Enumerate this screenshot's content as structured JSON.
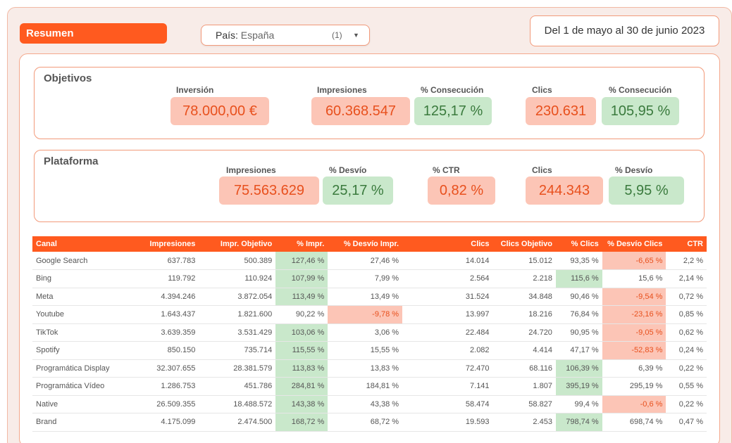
{
  "header": {
    "title": "Resumen",
    "country_label": "País",
    "country_value": "España",
    "country_count": "(1)",
    "date_range": "Del 1 de mayo al 30 de junio 2023"
  },
  "objetivos": {
    "title": "Objetivos",
    "inversion_label": "Inversión",
    "inversion_value": "78.000,00 €",
    "impresiones_label": "Impresiones",
    "impresiones_value": "60.368.547",
    "consecucion1_label": "% Consecución",
    "consecucion1_value": "125,17 %",
    "clics_label": "Clics",
    "clics_value": "230.631",
    "consecucion2_label": "% Consecución",
    "consecucion2_value": "105,95 %"
  },
  "plataforma": {
    "title": "Plataforma",
    "impresiones_label": "Impresiones",
    "impresiones_value": "75.563.629",
    "desvio1_label": "% Desvío",
    "desvio1_value": "25,17 %",
    "ctr_label": "% CTR",
    "ctr_value": "0,82 %",
    "clics_label": "Clics",
    "clics_value": "244.343",
    "desvio2_label": "% Desvío",
    "desvio2_value": "5,95 %"
  },
  "table": {
    "headers": [
      "Canal",
      "Impresiones",
      "Impr. Objetivo",
      "% Impr.",
      "% Desvío Impr.",
      "Clics",
      "Clics Objetivo",
      "% Clics",
      "% Desvío Clics",
      "CTR"
    ],
    "rows": [
      [
        "Google Search",
        "637.783",
        "500.389",
        "127,46 %",
        "27,46 %",
        "14.014",
        "15.012",
        "93,35 %",
        "-6,65 %",
        "2,2 %"
      ],
      [
        "Bing",
        "119.792",
        "110.924",
        "107,99 %",
        "7,99 %",
        "2.564",
        "2.218",
        "115,6 %",
        "15,6 %",
        "2,14 %"
      ],
      [
        "Meta",
        "4.394.246",
        "3.872.054",
        "113,49 %",
        "13,49 %",
        "31.524",
        "34.848",
        "90,46 %",
        "-9,54 %",
        "0,72 %"
      ],
      [
        "Youtube",
        "1.643.437",
        "1.821.600",
        "90,22 %",
        "-9,78 %",
        "13.997",
        "18.216",
        "76,84 %",
        "-23,16 %",
        "0,85 %"
      ],
      [
        "TikTok",
        "3.639.359",
        "3.531.429",
        "103,06 %",
        "3,06 %",
        "22.484",
        "24.720",
        "90,95 %",
        "-9,05 %",
        "0,62 %"
      ],
      [
        "Spotify",
        "850.150",
        "735.714",
        "115,55 %",
        "15,55 %",
        "2.082",
        "4.414",
        "47,17 %",
        "-52,83 %",
        "0,24 %"
      ],
      [
        "Programática Display",
        "32.307.655",
        "28.381.579",
        "113,83 %",
        "13,83 %",
        "72.470",
        "68.116",
        "106,39 %",
        "6,39 %",
        "0,22 %"
      ],
      [
        "Programática Vídeo",
        "1.286.753",
        "451.786",
        "284,81 %",
        "184,81 %",
        "7.141",
        "1.807",
        "395,19 %",
        "295,19 %",
        "0,55 %"
      ],
      [
        "Native",
        "26.509.355",
        "18.488.572",
        "143,38 %",
        "43,38 %",
        "58.474",
        "58.827",
        "99,4 %",
        "-0,6 %",
        "0,22 %"
      ],
      [
        "Brand",
        "4.175.099",
        "2.474.500",
        "168,72 %",
        "68,72 %",
        "19.593",
        "2.453",
        "798,74 %",
        "698,74 %",
        "0,47 %"
      ]
    ],
    "highlights": [
      [
        "",
        "",
        "",
        "g",
        "",
        "",
        "",
        "",
        "r",
        ""
      ],
      [
        "",
        "",
        "",
        "g",
        "",
        "",
        "",
        "g",
        "",
        ""
      ],
      [
        "",
        "",
        "",
        "g",
        "",
        "",
        "",
        "",
        "r",
        ""
      ],
      [
        "",
        "",
        "",
        "",
        "r",
        "",
        "",
        "",
        "r",
        ""
      ],
      [
        "",
        "",
        "",
        "g",
        "",
        "",
        "",
        "",
        "r",
        ""
      ],
      [
        "",
        "",
        "",
        "g",
        "",
        "",
        "",
        "",
        "r",
        ""
      ],
      [
        "",
        "",
        "",
        "g",
        "",
        "",
        "",
        "g",
        "",
        ""
      ],
      [
        "",
        "",
        "",
        "g",
        "",
        "",
        "",
        "g",
        "",
        ""
      ],
      [
        "",
        "",
        "",
        "g",
        "",
        "",
        "",
        "",
        "r",
        ""
      ],
      [
        "",
        "",
        "",
        "g",
        "",
        "",
        "",
        "g",
        "",
        ""
      ]
    ]
  },
  "colors": {
    "accent": "#ff5a1f",
    "positive_bg": "#c9e8cb",
    "negative_bg": "#fcc5b6"
  }
}
